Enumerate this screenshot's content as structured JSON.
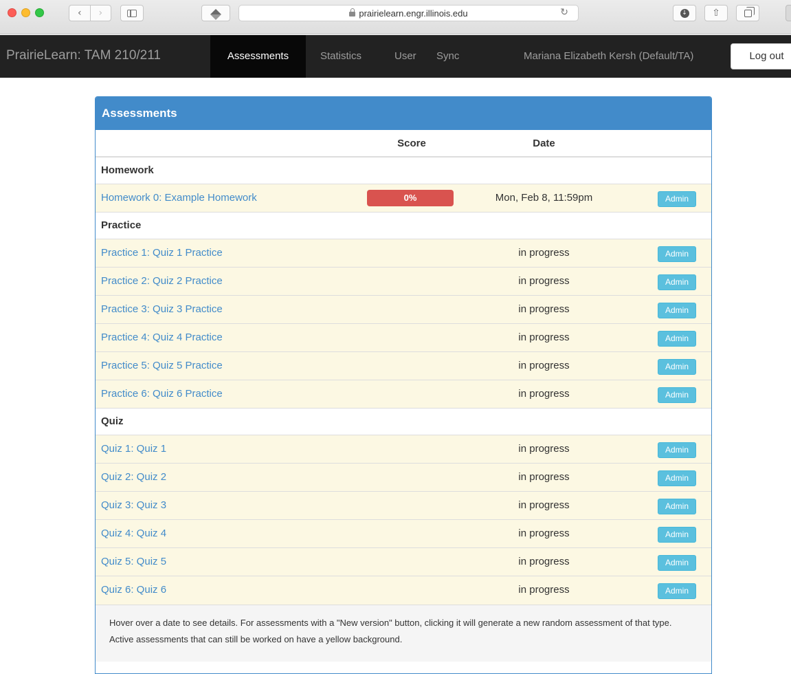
{
  "browser": {
    "url": "prairielearn.engr.illinois.edu",
    "back_glyph": "‹",
    "forward_glyph": "›",
    "reload_glyph": "↻",
    "download_glyph": "↓",
    "share_glyph": "⇧"
  },
  "navbar": {
    "brand": "PrairieLearn: TAM 210/211",
    "links": [
      "Assessments",
      "Statistics",
      "User",
      "Sync"
    ],
    "active": "Assessments",
    "username": "Mariana Elizabeth Kersh (Default/TA)",
    "logout_label": "Log out"
  },
  "panel": {
    "title": "Assessments",
    "columns": {
      "score": "Score",
      "date": "Date"
    },
    "admin_label": "Admin",
    "sections": [
      {
        "name": "Homework",
        "rows": [
          {
            "title": "Homework 0: Example Homework",
            "score": "0%",
            "date": "Mon, Feb 8, 11:59pm"
          }
        ]
      },
      {
        "name": "Practice",
        "rows": [
          {
            "title": "Practice 1: Quiz 1 Practice",
            "date": "in progress"
          },
          {
            "title": "Practice 2: Quiz 2 Practice",
            "date": "in progress"
          },
          {
            "title": "Practice 3: Quiz 3 Practice",
            "date": "in progress"
          },
          {
            "title": "Practice 4: Quiz 4 Practice",
            "date": "in progress"
          },
          {
            "title": "Practice 5: Quiz 5 Practice",
            "date": "in progress"
          },
          {
            "title": "Practice 6: Quiz 6 Practice",
            "date": "in progress"
          }
        ]
      },
      {
        "name": "Quiz",
        "rows": [
          {
            "title": "Quiz 1: Quiz 1",
            "date": "in progress"
          },
          {
            "title": "Quiz 2: Quiz 2",
            "date": "in progress"
          },
          {
            "title": "Quiz 3: Quiz 3",
            "date": "in progress"
          },
          {
            "title": "Quiz 4: Quiz 4",
            "date": "in progress"
          },
          {
            "title": "Quiz 5: Quiz 5",
            "date": "in progress"
          },
          {
            "title": "Quiz 6: Quiz 6",
            "date": "in progress"
          }
        ]
      }
    ],
    "footer": "Hover over a date to see details. For assessments with a \"New version\" button, clicking it will generate a new random assessment of that type. Active assessments that can still be worked on have a yellow background."
  },
  "colors": {
    "navbar_bg": "#222222",
    "panel_primary": "#428bca",
    "active_row_bg": "#fcf8e3",
    "danger": "#d9534f",
    "info": "#5bc0de"
  }
}
